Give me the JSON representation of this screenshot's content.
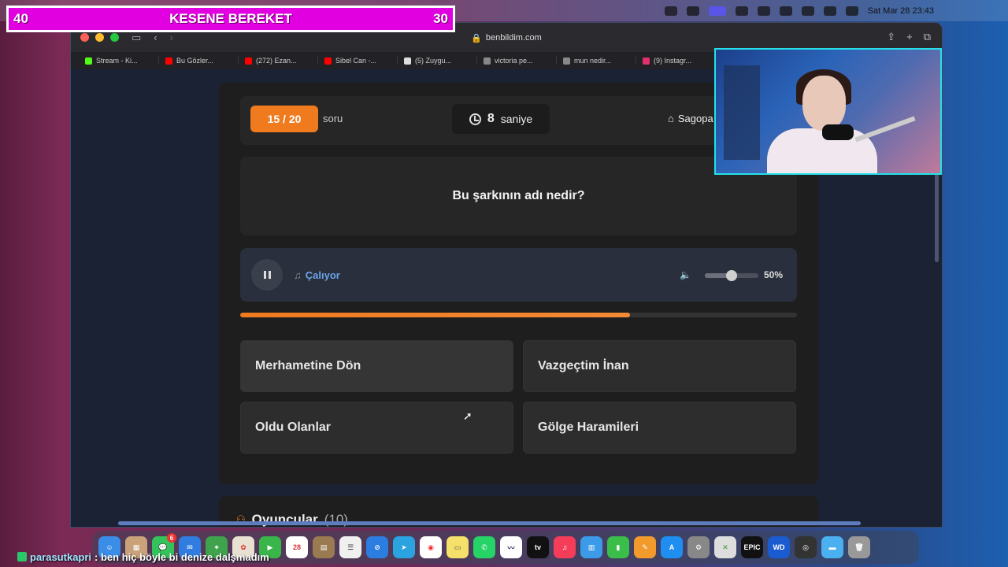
{
  "overlay": {
    "left_number": "40",
    "title": "KESENE BEREKET",
    "right_number": "30"
  },
  "menubar": {
    "datetime": "Sat Mar 28  23:43"
  },
  "browser": {
    "url": "benbildim.com",
    "tabs": [
      {
        "label": "Stream - Ki...",
        "color": "#53fc18"
      },
      {
        "label": "Bu Gözler...",
        "color": "#ff0000"
      },
      {
        "label": "(272) Ezan...",
        "color": "#ff0000"
      },
      {
        "label": "Sibel Can -...",
        "color": "#ff0000"
      },
      {
        "label": "(5) Zuygu...",
        "color": "#dddddd"
      },
      {
        "label": "victoria pe...",
        "color": "#888888"
      },
      {
        "label": "mun nedir...",
        "color": "#888888"
      },
      {
        "label": "(9) Instagr...",
        "color": "#e1306c"
      }
    ]
  },
  "quiz": {
    "question_counter": "15 / 20",
    "question_counter_label": "soru",
    "timer_value": "8",
    "timer_unit": "saniye",
    "creator": "Sagopa",
    "question": "Bu şarkının adı nedir?",
    "player_status": "Çalıyor",
    "volume": 0.5,
    "volume_label": "50%",
    "progress": 0.7,
    "answers": [
      "Merhametine Dön",
      "Vazgeçtim İnan",
      "Oldu Olanlar",
      "Gölge Haramileri"
    ]
  },
  "players": {
    "title": "Oyuncular",
    "count": "(10)"
  },
  "chat": {
    "user": "parasutkapri",
    "message": ": ben hiç böyle bi denize dalşmadım"
  },
  "colors": {
    "accent_orange": "#f07a1e",
    "overlay_magenta": "#e000e0",
    "webcam_border": "#25e0e8",
    "playing_blue": "#6aa4e8"
  },
  "dock": {
    "calendar_day": "28",
    "appletv_label": "tv",
    "epic_label": "EPIC",
    "wd_label": "WD",
    "messages_badge": "6"
  }
}
